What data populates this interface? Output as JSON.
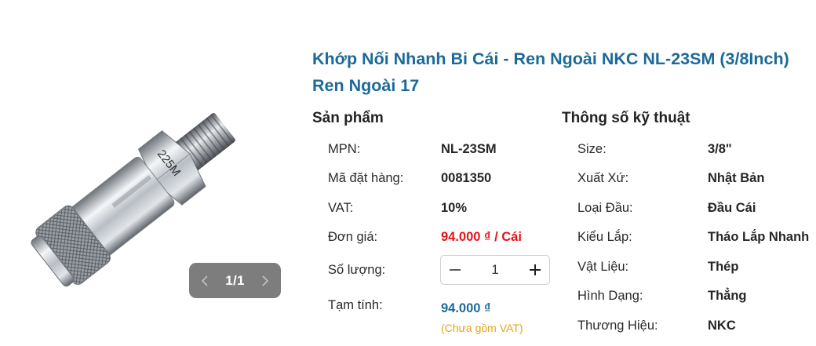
{
  "product": {
    "title": "Khớp Nối Nhanh Bi Cái - Ren Ngoài NKC NL-23SM (3/8Inch) Ren Ngoài 17",
    "image_marking": "225M"
  },
  "gallery": {
    "counter": "1/1"
  },
  "sections": {
    "product_heading": "Sản phẩm",
    "specs_heading": "Thông số kỹ thuật"
  },
  "product_info": {
    "mpn_label": "MPN:",
    "mpn": "NL-23SM",
    "order_code_label": "Mã đặt hàng:",
    "order_code": "0081350",
    "vat_label": "VAT:",
    "vat": "10%",
    "unit_price_label": "Đơn giá:",
    "unit_price": "94.000 ₫ / Cái",
    "quantity_label": "Số lượng:",
    "quantity": "1",
    "subtotal_label": "Tạm tính:",
    "subtotal": "94.000 ₫",
    "subtotal_note": "(Chưa gồm VAT)"
  },
  "specs": [
    {
      "label": "Size:",
      "value": "3/8\""
    },
    {
      "label": "Xuất Xứ:",
      "value": "Nhật Bản"
    },
    {
      "label": "Loại Đầu:",
      "value": "Đầu Cái"
    },
    {
      "label": "Kiểu Lắp:",
      "value": "Tháo Lắp Nhanh"
    },
    {
      "label": "Vật Liệu:",
      "value": "Thép"
    },
    {
      "label": "Hình Dạng:",
      "value": "Thẳng"
    },
    {
      "label": "Thương Hiệu:",
      "value": "NKC"
    }
  ],
  "icons": {
    "prev": "chevron-left-icon",
    "next": "chevron-right-icon",
    "minus": "minus-icon",
    "plus": "plus-icon"
  },
  "colors": {
    "title": "#1c6a98",
    "price": "#e4141b",
    "note": "#e8a317",
    "pager_bg": "#7d7d7d"
  }
}
